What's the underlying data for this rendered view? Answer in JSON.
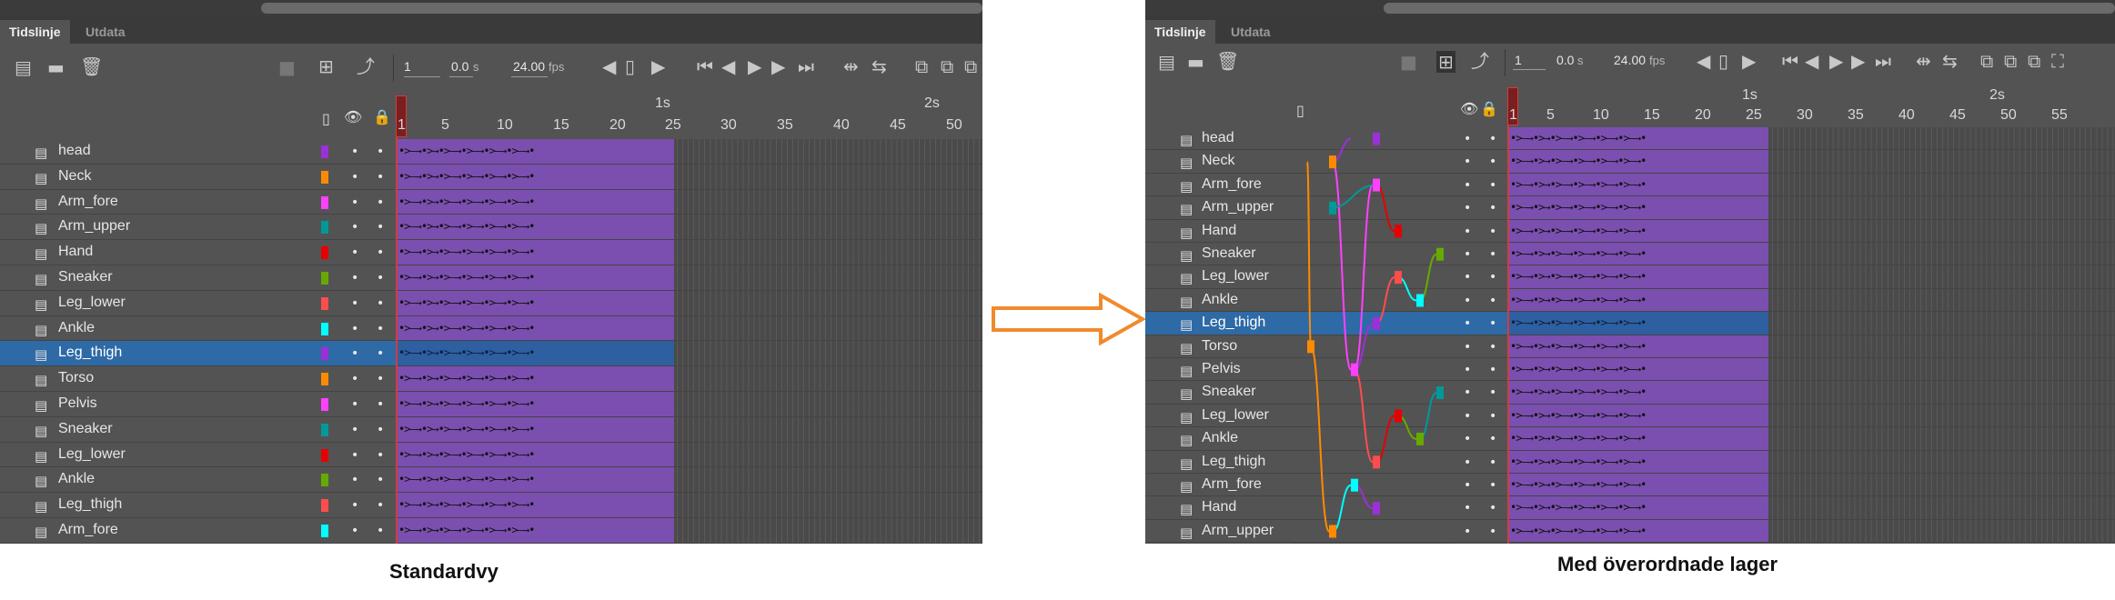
{
  "tabs": {
    "timeline": "Tidslinje",
    "output": "Utdata"
  },
  "toolbar": {
    "frame": "1",
    "time": "0.0",
    "time_unit": "s",
    "fps": "24.00",
    "fps_unit": "fps"
  },
  "ruler": {
    "ticks": [
      "1",
      "5",
      "10",
      "15",
      "20",
      "25",
      "30",
      "35",
      "40",
      "45",
      "50"
    ],
    "ticks_right": [
      "1",
      "5",
      "10",
      "15",
      "20",
      "25",
      "30",
      "35",
      "40",
      "45",
      "50",
      "55"
    ],
    "sec1": "1s",
    "sec2": "2s"
  },
  "left_layers": [
    "head",
    "Neck",
    "Arm_fore",
    "Arm_upper",
    "Hand",
    "Sneaker",
    "Leg_lower",
    "Ankle",
    "Leg_thigh",
    "Torso",
    "Pelvis",
    "Sneaker",
    "Leg_lower",
    "Ankle",
    "Leg_thigh",
    "Arm_fore"
  ],
  "right_layers": [
    "head",
    "Neck",
    "Arm_fore",
    "Arm_upper",
    "Hand",
    "Sneaker",
    "Leg_lower",
    "Ankle",
    "Leg_thigh",
    "Torso",
    "Pelvis",
    "Sneaker",
    "Leg_lower",
    "Ankle",
    "Leg_thigh",
    "Arm_fore",
    "Hand",
    "Arm_upper"
  ],
  "layer_colors": [
    "#9b30d9",
    "#ff8a00",
    "#ff40ff",
    "#009999",
    "#e60000",
    "#66aa00",
    "#ff4d4d",
    "#00ffff",
    "#9b30d9",
    "#ff8a00",
    "#ff40ff",
    "#009999",
    "#e60000",
    "#66aa00",
    "#ff4d4d",
    "#00ffff",
    "#9b30d9",
    "#ff8a00"
  ],
  "selected_layer": "Leg_thigh",
  "keyframes_text": "•>—→•>→•>—→•>—→•>—→•>—→•",
  "captions": {
    "left": "Standardvy",
    "right": "Med överordnade lager"
  },
  "icons": [
    "new-layer-icon",
    "folder-icon",
    "trash-icon",
    "camera-icon",
    "parenting-icon",
    "graph-icon",
    "outline-icon",
    "eye-icon",
    "lock-icon",
    "layer-icon",
    "step-back-icon",
    "phone-icon",
    "step-forward-icon",
    "go-first-icon",
    "prev-frame-icon",
    "play-icon",
    "next-frame-icon",
    "go-last-icon",
    "loop-icon",
    "onion-skin-icon"
  ]
}
